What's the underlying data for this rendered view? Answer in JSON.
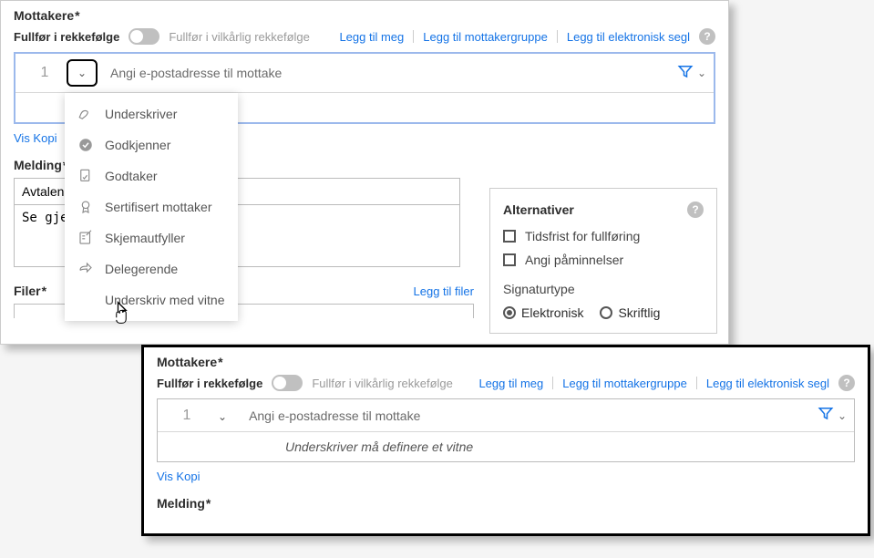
{
  "recipients": {
    "title": "Mottakere",
    "order_label": "Fullfør i rekkefølge",
    "order_alt": "Fullfør i vilkårlig rekkefølge",
    "add_me": "Legg til meg",
    "add_group": "Legg til mottakergruppe",
    "add_seal": "Legg til elektronisk segl",
    "row_number": "1",
    "email_placeholder": "Angi e-postadresse til mottake",
    "witness_note_full": "Underskriver må definere et vitne",
    "witness_note_partial": "finere et vitne",
    "show_copy": "Vis Kopi"
  },
  "dropdown": {
    "underskriver": "Underskriver",
    "godkjenner": "Godkjenner",
    "godtaker": "Godtaker",
    "sertifisert": "Sertifisert mottaker",
    "skjemautfyller": "Skjemautfyller",
    "delegerende": "Delegerende",
    "underskriv_vitne": "Underskriv med vitne"
  },
  "message": {
    "title": "Melding",
    "subject": "Avtalena",
    "body": "Se gjenno"
  },
  "files": {
    "title": "Filer",
    "add_files": "Legg til filer"
  },
  "alternatives": {
    "title": "Alternativer",
    "deadline": "Tidsfrist for fullføring",
    "reminders": "Angi påminnelser",
    "sig_type": "Signaturtype",
    "electronic": "Elektronisk",
    "written": "Skriftlig"
  }
}
